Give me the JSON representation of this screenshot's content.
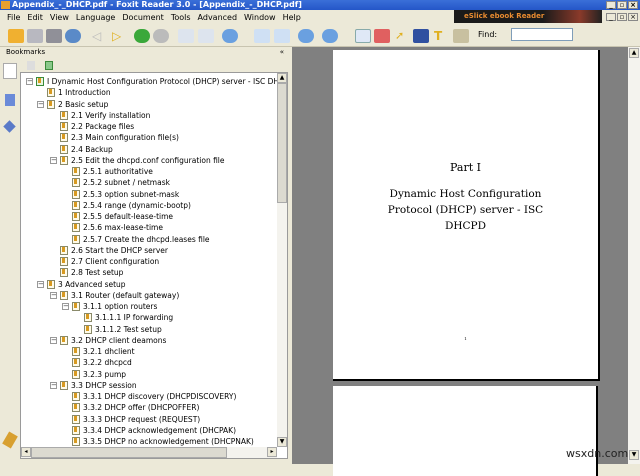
{
  "window": {
    "title": "Appendix_-_DHCP.pdf - Foxit Reader 3.0 - [Appendix_-_DHCP.pdf]"
  },
  "menu": [
    "File",
    "Edit",
    "View",
    "Language",
    "Document",
    "Tools",
    "Advanced",
    "Window",
    "Help"
  ],
  "ad_banner": "eSlick ebook Reader",
  "toolbar": {
    "find_label": "Find:",
    "find_value": ""
  },
  "bookmarks": {
    "header": "Bookmarks",
    "items": [
      {
        "label": "I Dynamic Host Configuration Protocol (DHCP) server - ISC DHCPD",
        "level": 0,
        "exp": true
      },
      {
        "label": "1 Introduction",
        "level": 1,
        "exp": false
      },
      {
        "label": "2 Basic setup",
        "level": 1,
        "exp": true
      },
      {
        "label": "2.1 Verify installation",
        "level": 2,
        "exp": false
      },
      {
        "label": "2.2 Package files",
        "level": 2,
        "exp": false
      },
      {
        "label": "2.3 Main configuration file(s)",
        "level": 2,
        "exp": false
      },
      {
        "label": "2.4 Backup",
        "level": 2,
        "exp": false
      },
      {
        "label": "2.5 Edit the dhcpd.conf configuration file",
        "level": 2,
        "exp": true
      },
      {
        "label": "2.5.1 authoritative",
        "level": 3,
        "exp": false
      },
      {
        "label": "2.5.2 subnet / netmask",
        "level": 3,
        "exp": false
      },
      {
        "label": "2.5.3 option subnet-mask",
        "level": 3,
        "exp": false
      },
      {
        "label": "2.5.4 range (dynamic-bootp)",
        "level": 3,
        "exp": false
      },
      {
        "label": "2.5.5 default-lease-time",
        "level": 3,
        "exp": false
      },
      {
        "label": "2.5.6 max-lease-time",
        "level": 3,
        "exp": false
      },
      {
        "label": "2.5.7 Create the dhcpd.leases file",
        "level": 3,
        "exp": false
      },
      {
        "label": "2.6 Start the DHCP server",
        "level": 2,
        "exp": false
      },
      {
        "label": "2.7 Client configuration",
        "level": 2,
        "exp": false
      },
      {
        "label": "2.8 Test setup",
        "level": 2,
        "exp": false
      },
      {
        "label": "3 Advanced setup",
        "level": 1,
        "exp": true
      },
      {
        "label": "3.1 Router (default gateway)",
        "level": 2,
        "exp": true
      },
      {
        "label": "3.1.1 option routers",
        "level": 3,
        "exp": true
      },
      {
        "label": "3.1.1.1 IP forwarding",
        "level": 4,
        "exp": false
      },
      {
        "label": "3.1.1.2 Test setup",
        "level": 4,
        "exp": false
      },
      {
        "label": "3.2 DHCP client deamons",
        "level": 2,
        "exp": true
      },
      {
        "label": "3.2.1 dhclient",
        "level": 3,
        "exp": false
      },
      {
        "label": "3.2.2 dhcpcd",
        "level": 3,
        "exp": false
      },
      {
        "label": "3.2.3 pump",
        "level": 3,
        "exp": false
      },
      {
        "label": "3.3 DHCP session",
        "level": 2,
        "exp": true
      },
      {
        "label": "3.3.1 DHCP discovery (DHCPDISCOVERY)",
        "level": 3,
        "exp": false
      },
      {
        "label": "3.3.2 DHCP offer (DHCPOFFER)",
        "level": 3,
        "exp": false
      },
      {
        "label": "3.3.3 DHCP request (REQUEST)",
        "level": 3,
        "exp": false
      },
      {
        "label": "3.3.4 DHCP acknowledgement (DHCPAK)",
        "level": 3,
        "exp": false
      },
      {
        "label": "3.3.5 DHCP no acknowledgement (DHCPNAK)",
        "level": 3,
        "exp": false
      }
    ]
  },
  "page": {
    "part": "Part I",
    "title_lines": [
      "Dynamic Host Configuration",
      "Protocol (DHCP) server - ISC",
      "DHCPD"
    ],
    "page_number": "1"
  },
  "watermark": "wsxdn.com"
}
